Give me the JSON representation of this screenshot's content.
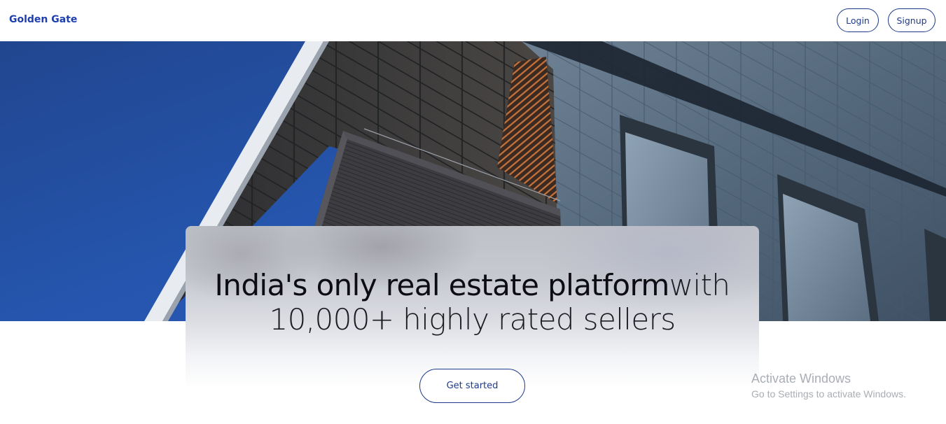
{
  "navbar": {
    "brand": "Golden Gate",
    "login_label": "Login",
    "signup_label": "Signup"
  },
  "hero": {
    "image_subject": "modern building facade against blue sky",
    "headline_strong": "India's only real estate platform",
    "headline_light_1": "with",
    "headline_light_2": "10,000+ highly rated sellers",
    "cta_label": "Get started"
  },
  "os_watermark": {
    "title": "Activate Windows",
    "subtitle": "Go to Settings to activate Windows."
  },
  "colors": {
    "brand": "#1e40af",
    "button_border": "#1e3a8a",
    "sky": "#2555ad"
  }
}
